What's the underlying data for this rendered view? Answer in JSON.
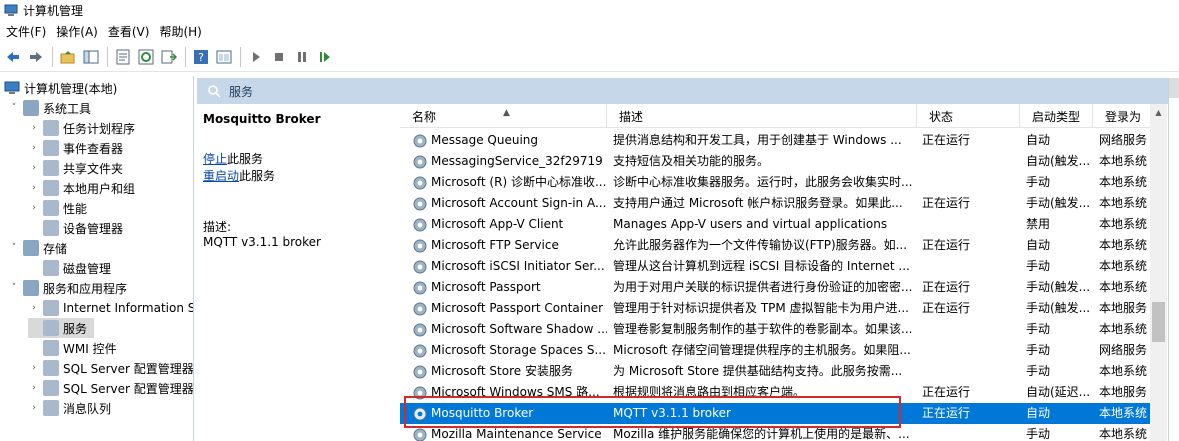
{
  "window": {
    "title": "计算机管理"
  },
  "menu": [
    "文件(F)",
    "操作(A)",
    "查看(V)",
    "帮助(H)"
  ],
  "toolbar": {
    "icons": [
      "back-arrow-icon",
      "forward-arrow-icon",
      "up-folder-icon",
      "show-tree-icon",
      "properties-icon",
      "refresh-icon",
      "export-list-icon",
      "help-icon",
      "console-view-icon",
      "start-service-icon",
      "stop-service-icon",
      "pause-service-icon",
      "resume-service-icon"
    ]
  },
  "tree": {
    "root": "计算机管理(本地)",
    "nodes": [
      {
        "label": "系统工具",
        "level": 1,
        "expanded": true
      },
      {
        "label": "任务计划程序",
        "level": 2
      },
      {
        "label": "事件查看器",
        "level": 2
      },
      {
        "label": "共享文件夹",
        "level": 2
      },
      {
        "label": "本地用户和组",
        "level": 2
      },
      {
        "label": "性能",
        "level": 2
      },
      {
        "label": "设备管理器",
        "level": 2,
        "noarrow": true
      },
      {
        "label": "存储",
        "level": 1,
        "expanded": true
      },
      {
        "label": "磁盘管理",
        "level": 2,
        "noarrow": true
      },
      {
        "label": "服务和应用程序",
        "level": 1,
        "expanded": true
      },
      {
        "label": "Internet Information S",
        "level": 2
      },
      {
        "label": "服务",
        "level": 2,
        "noarrow": true,
        "selected": true
      },
      {
        "label": "WMI 控件",
        "level": 2,
        "noarrow": true
      },
      {
        "label": "SQL Server 配置管理器",
        "level": 2
      },
      {
        "label": "SQL Server 配置管理器",
        "level": 2
      },
      {
        "label": "消息队列",
        "level": 2
      }
    ]
  },
  "services_panel": {
    "title": "服务",
    "detail": {
      "name": "Mosquitto Broker",
      "stop_link": "停止",
      "stop_suffix": "此服务",
      "restart_link": "重启动",
      "restart_suffix": "此服务",
      "desc_label": "描述:",
      "desc": "MQTT v3.1.1 broker"
    },
    "columns": [
      "名称",
      "描述",
      "状态",
      "启动类型",
      "登录为"
    ],
    "rows": [
      {
        "name": "Message Queuing",
        "desc": "提供消息结构和开发工具，用于创建基于 Windows ...",
        "status": "正在运行",
        "startup": "自动",
        "logon": "网络服务"
      },
      {
        "name": "MessagingService_32f29719",
        "desc": "支持短信及相关功能的服务。",
        "status": "",
        "startup": "自动(触发...",
        "logon": "本地系统"
      },
      {
        "name": "Microsoft (R) 诊断中心标准收...",
        "desc": "诊断中心标准收集器服务。运行时，此服务会收集实时...",
        "status": "",
        "startup": "手动",
        "logon": "本地系统"
      },
      {
        "name": "Microsoft Account Sign-in A...",
        "desc": "支持用户通过 Microsoft 帐户标识服务登录。如果此...",
        "status": "正在运行",
        "startup": "手动(触发...",
        "logon": "本地系统"
      },
      {
        "name": "Microsoft App-V Client",
        "desc": "Manages App-V users and virtual applications",
        "status": "",
        "startup": "禁用",
        "logon": "本地系统"
      },
      {
        "name": "Microsoft FTP Service",
        "desc": "允许此服务器作为一个文件传输协议(FTP)服务器。如...",
        "status": "正在运行",
        "startup": "自动",
        "logon": "本地系统"
      },
      {
        "name": "Microsoft iSCSI Initiator Ser...",
        "desc": "管理从这台计算机到远程 iSCSI 目标设备的 Internet ...",
        "status": "",
        "startup": "手动",
        "logon": "本地系统"
      },
      {
        "name": "Microsoft Passport",
        "desc": "为用于对用户关联的标识提供者进行身份验证的加密密...",
        "status": "正在运行",
        "startup": "手动(触发...",
        "logon": "本地系统"
      },
      {
        "name": "Microsoft Passport Container",
        "desc": "管理用于针对标识提供者及 TPM 虚拟智能卡为用户进...",
        "status": "正在运行",
        "startup": "手动(触发...",
        "logon": "本地服务"
      },
      {
        "name": "Microsoft Software Shadow ...",
        "desc": "管理卷影复制服务制作的基于软件的卷影副本。如果该...",
        "status": "",
        "startup": "手动",
        "logon": "本地系统"
      },
      {
        "name": "Microsoft Storage Spaces S...",
        "desc": "Microsoft 存储空间管理提供程序的主机服务。如果阻...",
        "status": "",
        "startup": "手动",
        "logon": "网络服务"
      },
      {
        "name": "Microsoft Store 安装服务",
        "desc": "为 Microsoft Store 提供基础结构支持。此服务按需...",
        "status": "",
        "startup": "手动",
        "logon": "本地系统"
      },
      {
        "name": "Microsoft Windows SMS 路...",
        "desc": "根据规则将消息路由到相应客户端。",
        "status": "正在运行",
        "startup": "自动(延迟...",
        "logon": "本地服务"
      },
      {
        "name": "Mosquitto Broker",
        "desc": "MQTT v3.1.1 broker",
        "status": "正在运行",
        "startup": "自动",
        "logon": "本地系统",
        "selected": true
      },
      {
        "name": "Mozilla Maintenance Service",
        "desc": "Mozilla 维护服务能确保您的计算机上使用的是最新、...",
        "status": "",
        "startup": "手动",
        "logon": "本地系统"
      }
    ]
  },
  "colors": {
    "selection": "#0078d7",
    "header_band": "#c7d7ea",
    "highlight_box": "#d42a2a"
  }
}
